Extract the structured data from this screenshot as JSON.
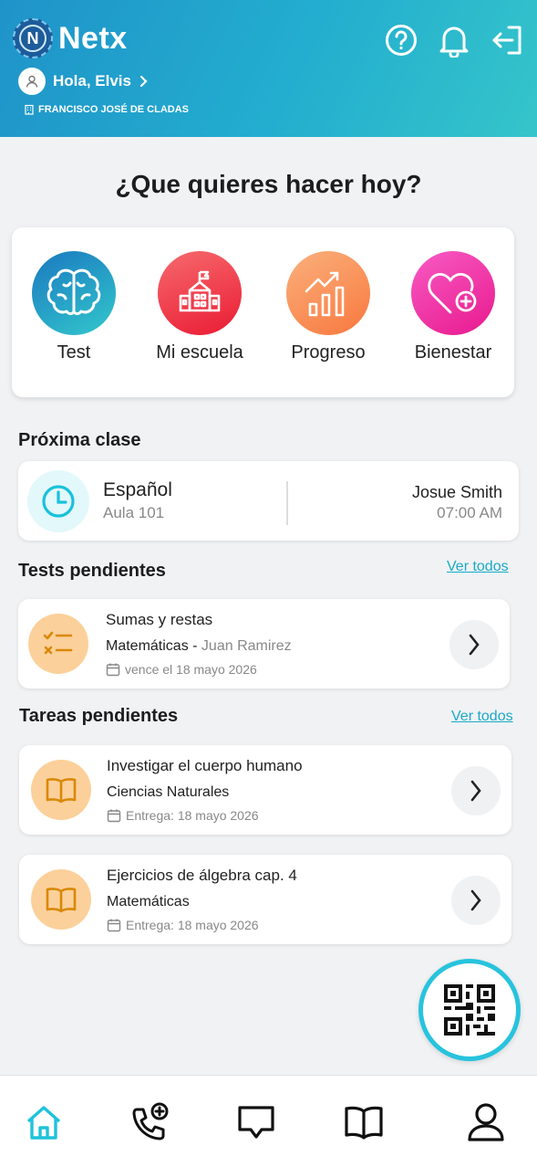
{
  "app": {
    "brand": "Netx",
    "logo_letter": "N"
  },
  "header": {
    "greeting": "Hola, Elvis",
    "school": "FRANCISCO JOSÉ DE CLADAS",
    "icons": [
      "help-icon",
      "bell-icon",
      "logout-icon"
    ]
  },
  "main_title": "¿Que quieres hacer hoy?",
  "actions": [
    {
      "label": "Test",
      "icon": "brain-icon",
      "color": "#1f8fc4"
    },
    {
      "label": "Mi escuela",
      "icon": "school-icon",
      "color": "#f0394b"
    },
    {
      "label": "Progreso",
      "icon": "chart-icon",
      "color": "#f98a4a"
    },
    {
      "label": "Bienestar",
      "icon": "heart-plus-icon",
      "color": "#ee2a9f"
    }
  ],
  "next_class": {
    "section_title": "Próxima clase",
    "subject": "Español",
    "room": "Aula 101",
    "teacher": "Josue Smith",
    "time": "07:00 AM"
  },
  "tests": {
    "section_title": "Tests pendientes",
    "see_all": "Ver todos",
    "items": [
      {
        "title": "Sumas y restas",
        "subject": "Matemáticas - ",
        "teacher": "Juan Ramirez",
        "date": "vence el 18 mayo 2026"
      }
    ]
  },
  "tasks": {
    "section_title": "Tareas pendientes",
    "see_all": "Ver todos",
    "items": [
      {
        "title": "Investigar el cuerpo humano",
        "subject": "Ciencias Naturales",
        "date": "Entrega: 18 mayo 2026"
      },
      {
        "title": "Ejercicios de álgebra cap. 4",
        "subject": "Matemáticas",
        "date": "Entrega: 18 mayo 2026"
      }
    ]
  },
  "fab": {
    "icon": "qr-code-icon"
  },
  "bottom_nav": [
    "home-icon",
    "phone-plus-icon",
    "chat-icon",
    "book-icon",
    "user-icon"
  ],
  "colors": {
    "accent": "#27c3dd",
    "header_start": "#1f93c9",
    "header_end": "#35c5ca"
  }
}
